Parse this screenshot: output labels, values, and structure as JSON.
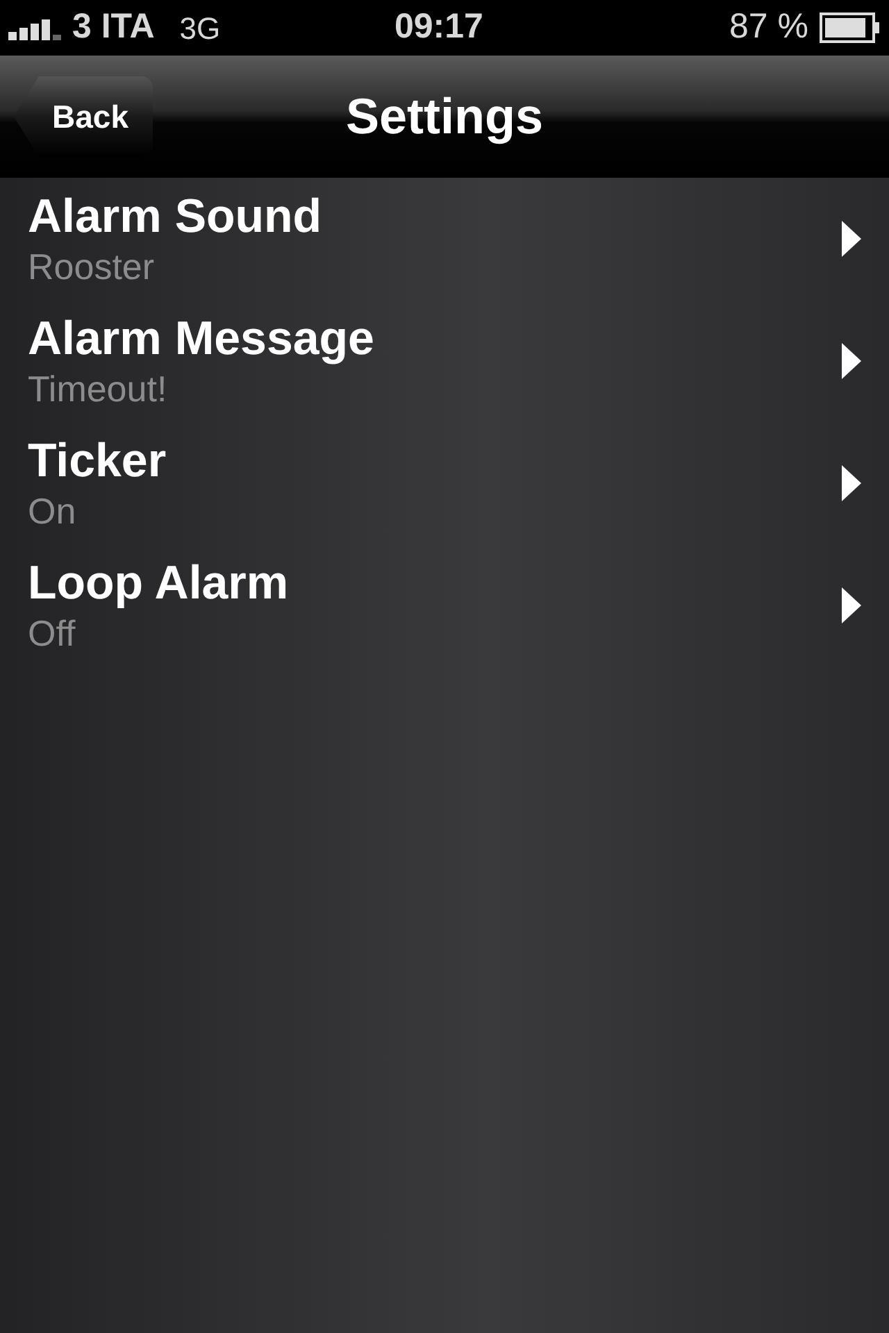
{
  "status_bar": {
    "carrier": "3 ITA",
    "network": "3G",
    "time": "09:17",
    "battery": "87 %"
  },
  "nav_bar": {
    "back": "Back",
    "title": "Settings"
  },
  "rows": [
    {
      "title": "Alarm Sound",
      "value": "Rooster"
    },
    {
      "title": "Alarm Message",
      "value": "Timeout!"
    },
    {
      "title": "Ticker",
      "value": "On"
    },
    {
      "title": "Loop Alarm",
      "value": "Off"
    }
  ]
}
